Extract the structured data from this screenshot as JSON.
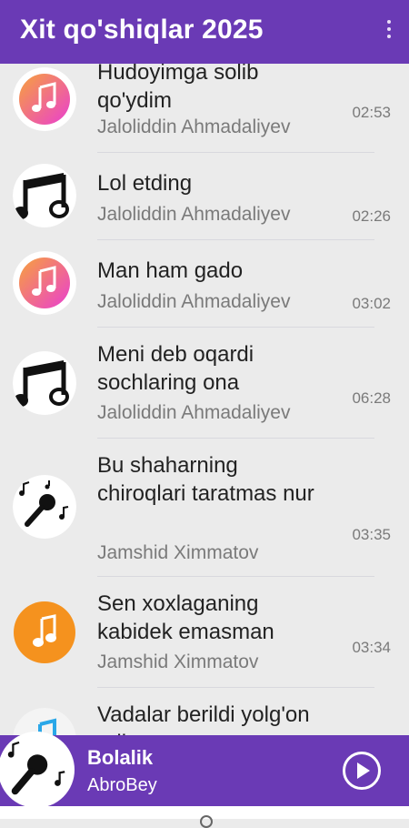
{
  "app": {
    "title": "Xit qo'shiqlar 2025"
  },
  "songs": [
    {
      "title": "Hudoyimga solib qo'ydim",
      "artist": "Jaloliddin Ahmadaliyev",
      "duration": "02:53",
      "icon": "music-note-pink-icon"
    },
    {
      "title": "Lol etding",
      "artist": "Jaloliddin Ahmadaliyev",
      "duration": "02:26",
      "icon": "music-notes-black-icon"
    },
    {
      "title": "Man ham gado",
      "artist": "Jaloliddin Ahmadaliyev",
      "duration": "03:02",
      "icon": "music-note-pink-icon"
    },
    {
      "title": "Meni deb oqardi sochlaring ona",
      "artist": "Jaloliddin Ahmadaliyev",
      "duration": "06:28",
      "icon": "music-notes-black-icon"
    },
    {
      "title": "Bu shaharning chiroqlari taratmas nur",
      "artist": "Jamshid Ximmatov",
      "duration": "03:35",
      "icon": "microphone-icon"
    },
    {
      "title": "Sen xoxlaganing kabidek emasman",
      "artist": "Jamshid Ximmatov",
      "duration": "03:34",
      "icon": "music-note-orange-icon"
    },
    {
      "title": "Vadalar berildi yolg'on edi",
      "artist": "",
      "duration": "",
      "icon": "music-note-blue-icon"
    }
  ],
  "player": {
    "title": "Bolalik",
    "artist": "AbroBey",
    "icon": "microphone-icon",
    "play_icon": "play-icon"
  },
  "colors": {
    "primary": "#6a3ab5",
    "pink": "#ea4cc0",
    "orange": "#f5921e"
  }
}
